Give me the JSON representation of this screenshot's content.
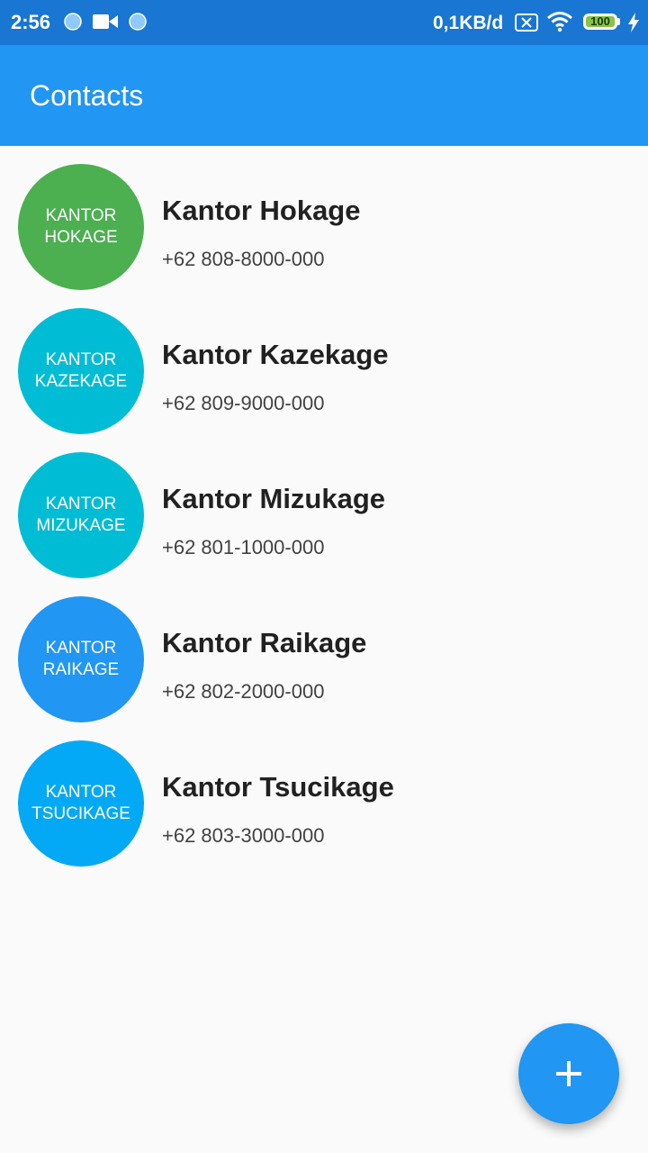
{
  "status_bar": {
    "time": "2:56",
    "speed": "0,1KB/d",
    "battery": "100",
    "battery_level": 1.0,
    "icons": [
      "notification-dot-icon",
      "video-camera-icon",
      "notification-dot-icon",
      "sim-off-icon",
      "wifi-icon",
      "battery-icon",
      "charging-icon"
    ]
  },
  "app_bar": {
    "title": "Contacts",
    "color": "#2196f3"
  },
  "contacts": [
    {
      "avatar_text": "KANTOR\nHOKAGE",
      "name": "Kantor Hokage",
      "phone": "+62 808-8000-000",
      "color": "#4caf50"
    },
    {
      "avatar_text": "KANTOR\nKAZEKAGE",
      "name": "Kantor Kazekage",
      "phone": "+62 809-9000-000",
      "color": "#00bcd4"
    },
    {
      "avatar_text": "KANTOR\nMIZUKAGE",
      "name": "Kantor Mizukage",
      "phone": "+62 801-1000-000",
      "color": "#00bcd4"
    },
    {
      "avatar_text": "KANTOR\nRAIKAGE",
      "name": "Kantor Raikage",
      "phone": "+62 802-2000-000",
      "color": "#2196f3"
    },
    {
      "avatar_text": "KANTOR\nTSUCIKAGE",
      "name": "Kantor Tsucikage",
      "phone": "+62 803-3000-000",
      "color": "#03a9f4"
    }
  ],
  "fab": {
    "icon": "plus-icon",
    "color": "#2196f3"
  }
}
